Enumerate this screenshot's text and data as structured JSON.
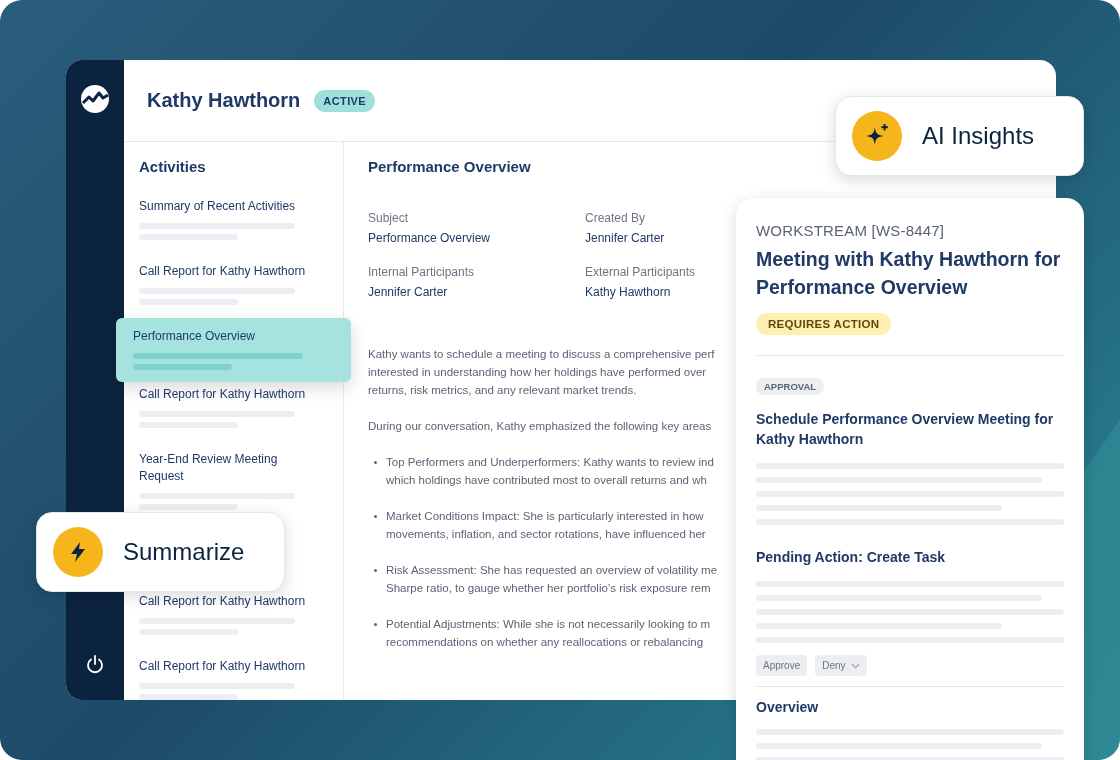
{
  "header": {
    "name": "Kathy Hawthorn",
    "status": "ACTIVE"
  },
  "activities": {
    "title": "Activities",
    "items": [
      {
        "title": "Summary of Recent Activities",
        "selected": false
      },
      {
        "title": "Call Report for Kathy Hawthorn",
        "selected": false
      },
      {
        "title": "Performance Overview",
        "selected": true
      },
      {
        "title": "Call Report for Kathy Hawthorn",
        "selected": false
      },
      {
        "title": "Year-End Review Meeting Request",
        "selected": false
      },
      {
        "title": "Call Report for Kathy Hawthorn",
        "selected": false
      },
      {
        "title": "Call Report for Kathy Hawthorn",
        "selected": false
      }
    ]
  },
  "detail": {
    "title": "Performance Overview",
    "fields": [
      {
        "label": "Subject",
        "value": "Performance Overview"
      },
      {
        "label": "Created By",
        "value": "Jennifer Carter"
      },
      {
        "label": "Internal Participants",
        "value": "Jennifer Carter"
      },
      {
        "label": "External Participants",
        "value": "Kathy Hawthorn"
      }
    ],
    "paragraphs": [
      {
        "kind": "text",
        "lines": [
          "Kathy wants to schedule a meeting to discuss a comprehensive perf",
          "interested in understanding how her holdings have performed over",
          "returns, risk metrics, and any relevant market trends."
        ]
      },
      {
        "kind": "text",
        "lines": [
          "During our conversation, Kathy emphasized the following key areas"
        ]
      },
      {
        "kind": "bullet",
        "lines": [
          "Top Performers and Underperformers: Kathy wants to review ind",
          "which holdings have contributed most to overall returns and wh"
        ]
      },
      {
        "kind": "bullet",
        "lines": [
          "Market Conditions Impact: She is particularly interested in how",
          "movements, inflation, and sector rotations, have influenced her"
        ]
      },
      {
        "kind": "bullet",
        "lines": [
          "Risk Assessment: She has requested an overview of volatility me",
          "Sharpe ratio, to gauge whether her portfolio’s risk exposure rem"
        ]
      },
      {
        "kind": "bullet",
        "lines": [
          "Potential Adjustments: While she is not necessarily looking to m",
          "recommendations on whether any reallocations or rebalancing"
        ]
      }
    ]
  },
  "workstream_card": {
    "eyebrow": "WORKSTREAM [WS-8447]",
    "title": "Meeting with Kathy Hawthorn for Performance Overview",
    "status": "REQUIRES ACTION",
    "sections": [
      {
        "tag": "APPROVAL",
        "title": "Schedule Performance Overview Meeting for Kathy Hawthorn"
      },
      {
        "title": "Pending Action: Create Task",
        "actions": [
          {
            "label": "Approve",
            "kind": "button"
          },
          {
            "label": "Deny",
            "kind": "dropdown"
          }
        ]
      },
      {
        "title": "Overview"
      }
    ]
  },
  "ai_insights_button": {
    "label": "AI Insights"
  },
  "summarize_button": {
    "label": "Summarize"
  }
}
